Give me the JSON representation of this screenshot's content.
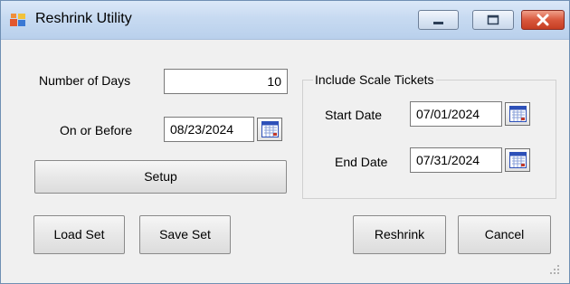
{
  "window": {
    "title": "Reshrink Utility"
  },
  "left": {
    "days_label": "Number of Days",
    "days_value": "10",
    "on_or_before_label": "On or Before",
    "on_or_before_value": "08/23/2024",
    "setup_button": "Setup"
  },
  "scale_tickets": {
    "group_title": "Include Scale Tickets",
    "start_label": "Start Date",
    "start_value": "07/01/2024",
    "end_label": "End Date",
    "end_value": "07/31/2024"
  },
  "buttons": {
    "load_set": "Load Set",
    "save_set": "Save Set",
    "reshrink": "Reshrink",
    "cancel": "Cancel"
  },
  "colors": {
    "titlebar": "#c7daf1",
    "close_button": "#d9583d",
    "calendar_accent": "#2d50b8"
  },
  "icons": [
    "app-icon",
    "minimize-icon",
    "maximize-icon",
    "close-icon",
    "calendar-icon",
    "resize-grip-icon"
  ]
}
